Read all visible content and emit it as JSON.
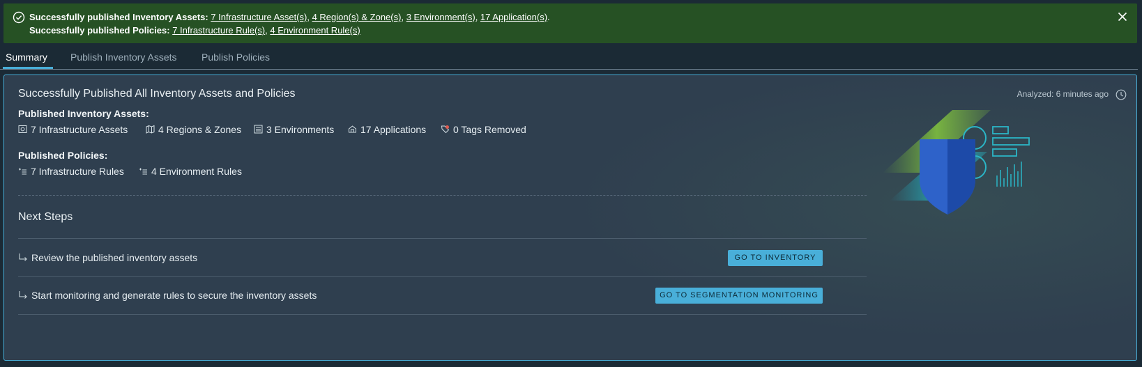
{
  "banner": {
    "line1_prefix": "Successfully published Inventory Assets:",
    "line1_links": [
      "7 Infrastructure Asset(s)",
      "4 Region(s) & Zone(s)",
      "3 Environment(s)",
      "17 Application(s)"
    ],
    "line1_end": ".",
    "line2_prefix": "Successfully published Policies:",
    "line2_links": [
      "7 Infrastructure Rule(s)",
      "4 Environment Rule(s)"
    ],
    "bg_color": "#265124",
    "icons": {
      "status": "check-circle-icon",
      "close": "close-icon"
    }
  },
  "tabs": [
    {
      "label": "Summary",
      "active": true
    },
    {
      "label": "Publish Inventory Assets",
      "active": false
    },
    {
      "label": "Publish Policies",
      "active": false
    }
  ],
  "card": {
    "title": "Successfully Published All Inventory Assets and Policies",
    "analyzed": "Analyzed: 6 minutes ago",
    "inventory_label": "Published Inventory Assets:",
    "inventory_items": [
      {
        "icon": "infrastructure-icon",
        "text": "7 Infrastructure Assets"
      },
      {
        "icon": "map-icon",
        "text": "4 Regions & Zones"
      },
      {
        "icon": "environment-icon",
        "text": "3 Environments"
      },
      {
        "icon": "applications-icon",
        "text": "17 Applications"
      },
      {
        "icon": "tag-removed-icon",
        "text": "0 Tags Removed"
      }
    ],
    "policies_label": "Published Policies:",
    "policy_items": [
      {
        "icon": "rules-icon",
        "text": "7 Infrastructure Rules"
      },
      {
        "icon": "rules-icon",
        "text": "4 Environment Rules"
      }
    ],
    "next_steps_title": "Next Steps",
    "steps": [
      {
        "text": "Review the published inventory assets",
        "button": "GO TO INVENTORY"
      },
      {
        "text": "Start monitoring and generate rules to secure the inventory assets",
        "button": "GO TO SEGMENTATION MONITORING"
      }
    ]
  },
  "colors": {
    "accent": "#49afd9",
    "success_banner": "#265124",
    "card_bg": "#2f3f4f",
    "page_bg": "#1b2a35"
  }
}
